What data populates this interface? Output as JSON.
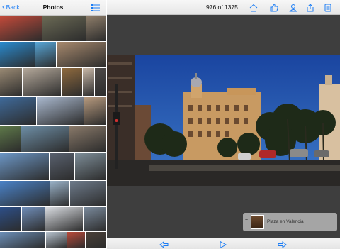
{
  "left_nav": {
    "back_label": "Back",
    "title": "Photos",
    "list_icon": "list-icon",
    "accent": "#1a7cf5"
  },
  "thumbnail_rows": [
    [
      "#c44a3a",
      "#6b6a55",
      "#8f7e6a"
    ],
    [
      "#2a8bd0",
      "#57a7d8",
      "#a88a6e"
    ],
    [
      "#9a8a74",
      "#b5a99b",
      "#8f6a3e",
      "#c8b8a8",
      "#4e4a48"
    ],
    [
      "#3f6a9a",
      "#aab9cf",
      "#b79a7e"
    ],
    [
      "#5f7a4a",
      "#6e8fa7",
      "#8a7a6a"
    ],
    [
      "#6d98c8",
      "#5a6270",
      "#7f8f9a"
    ],
    [
      "#4a82c8",
      "#9ab2c8",
      "#6d7a8a"
    ],
    [
      "#2d4f88",
      "#6f8db8",
      "#dadde2",
      "#7a8a9c"
    ],
    [
      "#6c8fb8",
      "#b8c4d0",
      "#b94a3a",
      "#4a4038"
    ]
  ],
  "viewer": {
    "counter": "976 of 1375",
    "caption": "Plaza en Valencia",
    "caption_prefix": "=",
    "sky_color": "#1f4fa8"
  },
  "toolbar_icons": [
    "home-icon",
    "thumbs-up-icon",
    "person-icon",
    "share-icon",
    "info-icon"
  ],
  "bottom_icons": [
    "previous-arrow-icon",
    "play-icon",
    "next-arrow-icon"
  ]
}
